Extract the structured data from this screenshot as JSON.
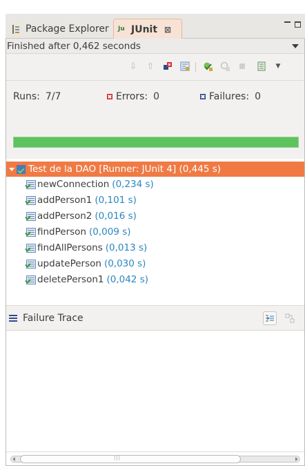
{
  "tabs": [
    {
      "label": "Package Explorer",
      "icon": "package-explorer-icon",
      "active": false
    },
    {
      "label": "JUnit",
      "icon": "junit-icon",
      "active": true
    }
  ],
  "tab_close_glyph": "⊠",
  "status": {
    "text": "Finished after 0,462 seconds"
  },
  "toolbar": {
    "buttons": [
      "next-failure-icon",
      "previous-failure-icon",
      "show-failures-only-icon",
      "scroll-lock-icon",
      "rerun-test-icon",
      "rerun-failed-first-icon",
      "stop-icon",
      "history-icon",
      "view-menu-icon"
    ]
  },
  "counters": {
    "runs_label": "Runs:",
    "runs_value": "7/7",
    "errors_label": "Errors:",
    "errors_value": "0",
    "failures_label": "Failures:",
    "failures_value": "0"
  },
  "progress": {
    "fraction": 1.0,
    "color": "#5dc45d"
  },
  "tree": {
    "root": {
      "label": "Test de la DAO [Runner: JUnit 4] (0,445 s)",
      "selected_color": "#f07a44"
    },
    "items": [
      {
        "name": "newConnection",
        "time": "(0,234 s)"
      },
      {
        "name": "addPerson1",
        "time": "(0,101 s)"
      },
      {
        "name": "addPerson2",
        "time": "(0,016 s)"
      },
      {
        "name": "findPerson",
        "time": "(0,009 s)"
      },
      {
        "name": "findAllPersons",
        "time": "(0,013 s)"
      },
      {
        "name": "updatePerson",
        "time": "(0,030 s)"
      },
      {
        "name": "deletePerson1",
        "time": "(0,042 s)"
      }
    ]
  },
  "trace": {
    "title": "Failure Trace"
  },
  "colors": {
    "accent": "#f07a44",
    "time_text": "#2a86c2",
    "error": "#d32b2b",
    "failure": "#2f4a8a"
  }
}
